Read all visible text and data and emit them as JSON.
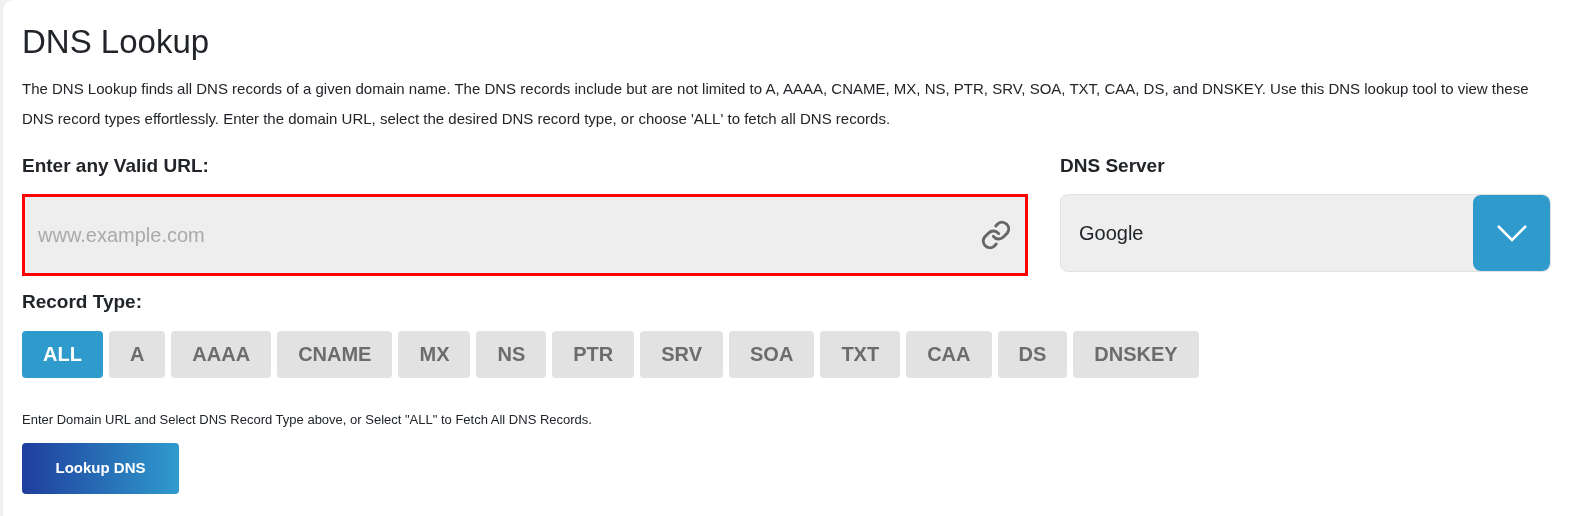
{
  "title": "DNS Lookup",
  "description": "The DNS Lookup finds all DNS records of a given domain name. The DNS records include but are not limited to A, AAAA, CNAME, MX, NS, PTR, SRV, SOA, TXT, CAA, DS, and DNSKEY. Use this DNS lookup tool to view these DNS record types effortlessly. Enter the domain URL, select the desired DNS record type, or choose 'ALL' to fetch all DNS records.",
  "url_field": {
    "label": "Enter any Valid URL:",
    "placeholder": "www.example.com"
  },
  "dns_server": {
    "label": "DNS Server",
    "value": "Google"
  },
  "record_type": {
    "label": "Record Type:",
    "options": [
      {
        "label": "ALL",
        "selected": true
      },
      {
        "label": "A",
        "selected": false
      },
      {
        "label": "AAAA",
        "selected": false
      },
      {
        "label": "CNAME",
        "selected": false
      },
      {
        "label": "MX",
        "selected": false
      },
      {
        "label": "NS",
        "selected": false
      },
      {
        "label": "PTR",
        "selected": false
      },
      {
        "label": "SRV",
        "selected": false
      },
      {
        "label": "SOA",
        "selected": false
      },
      {
        "label": "TXT",
        "selected": false
      },
      {
        "label": "CAA",
        "selected": false
      },
      {
        "label": "DS",
        "selected": false
      },
      {
        "label": "DNSKEY",
        "selected": false
      }
    ]
  },
  "hint": "Enter Domain URL and Select DNS Record Type above, or Select \"ALL\" to Fetch All DNS Records.",
  "submit": "Lookup DNS"
}
